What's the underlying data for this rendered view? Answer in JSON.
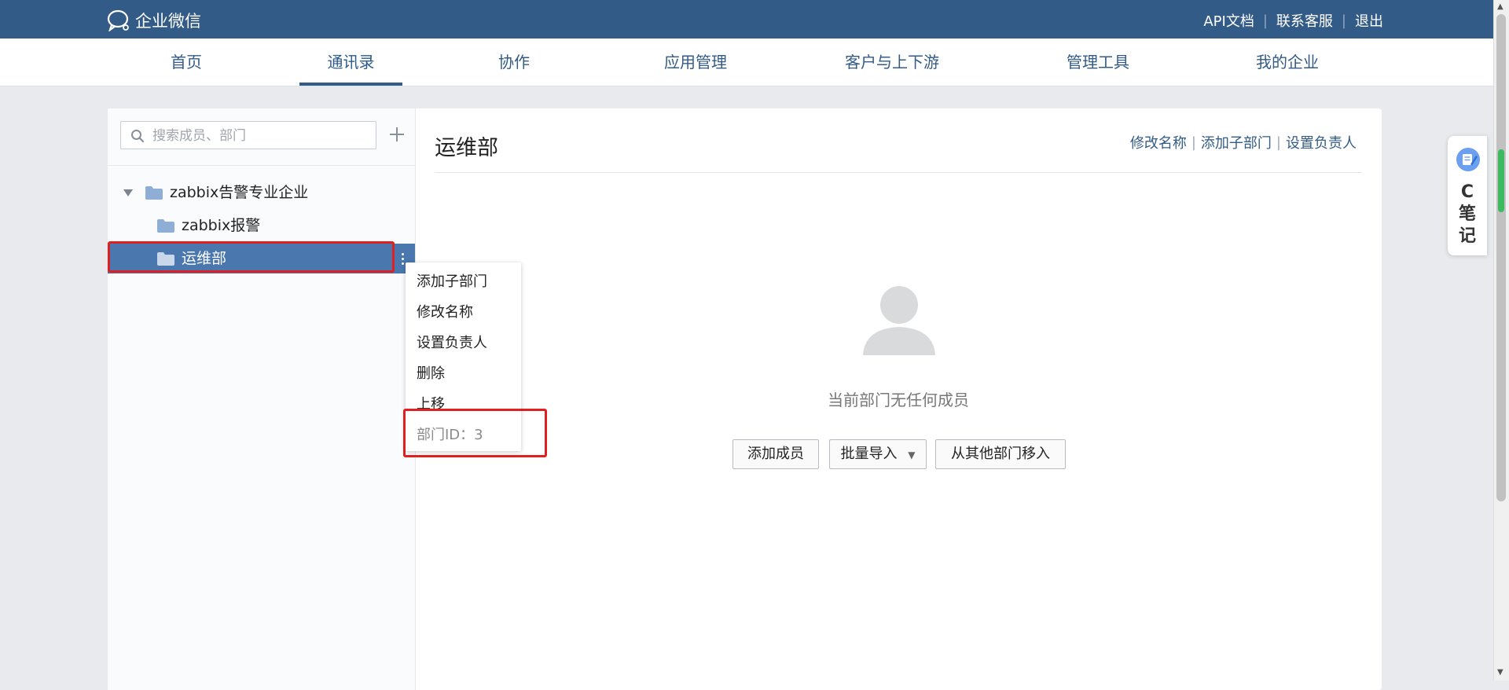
{
  "header": {
    "logo_text": "企业微信",
    "links": [
      "API文档",
      "联系客服",
      "退出"
    ]
  },
  "nav": {
    "tabs": [
      "首页",
      "通讯录",
      "协作",
      "应用管理",
      "客户与上下游",
      "管理工具",
      "我的企业"
    ],
    "active": "通讯录"
  },
  "sidebar": {
    "search_placeholder": "搜索成员、部门",
    "tree": {
      "root": "zabbix告警专业企业",
      "children": [
        "zabbix报警",
        "运维部"
      ],
      "selected": "运维部"
    }
  },
  "context_menu": {
    "items": [
      "添加子部门",
      "修改名称",
      "设置负责人",
      "删除",
      "上移"
    ],
    "dept_id": "部门ID：3"
  },
  "main": {
    "title": "运维部",
    "actions": [
      "修改名称",
      "添加子部门",
      "设置负责人"
    ],
    "empty_text": "当前部门无任何成员",
    "buttons": {
      "add_member": "添加成员",
      "batch_import": "批量导入",
      "move_from_other": "从其他部门移入"
    }
  },
  "side_widget": {
    "text": "C\n笔\n记"
  },
  "colors": {
    "brand": "#335b87",
    "selected_row": "#4a77ad",
    "highlight": "#e02020"
  }
}
